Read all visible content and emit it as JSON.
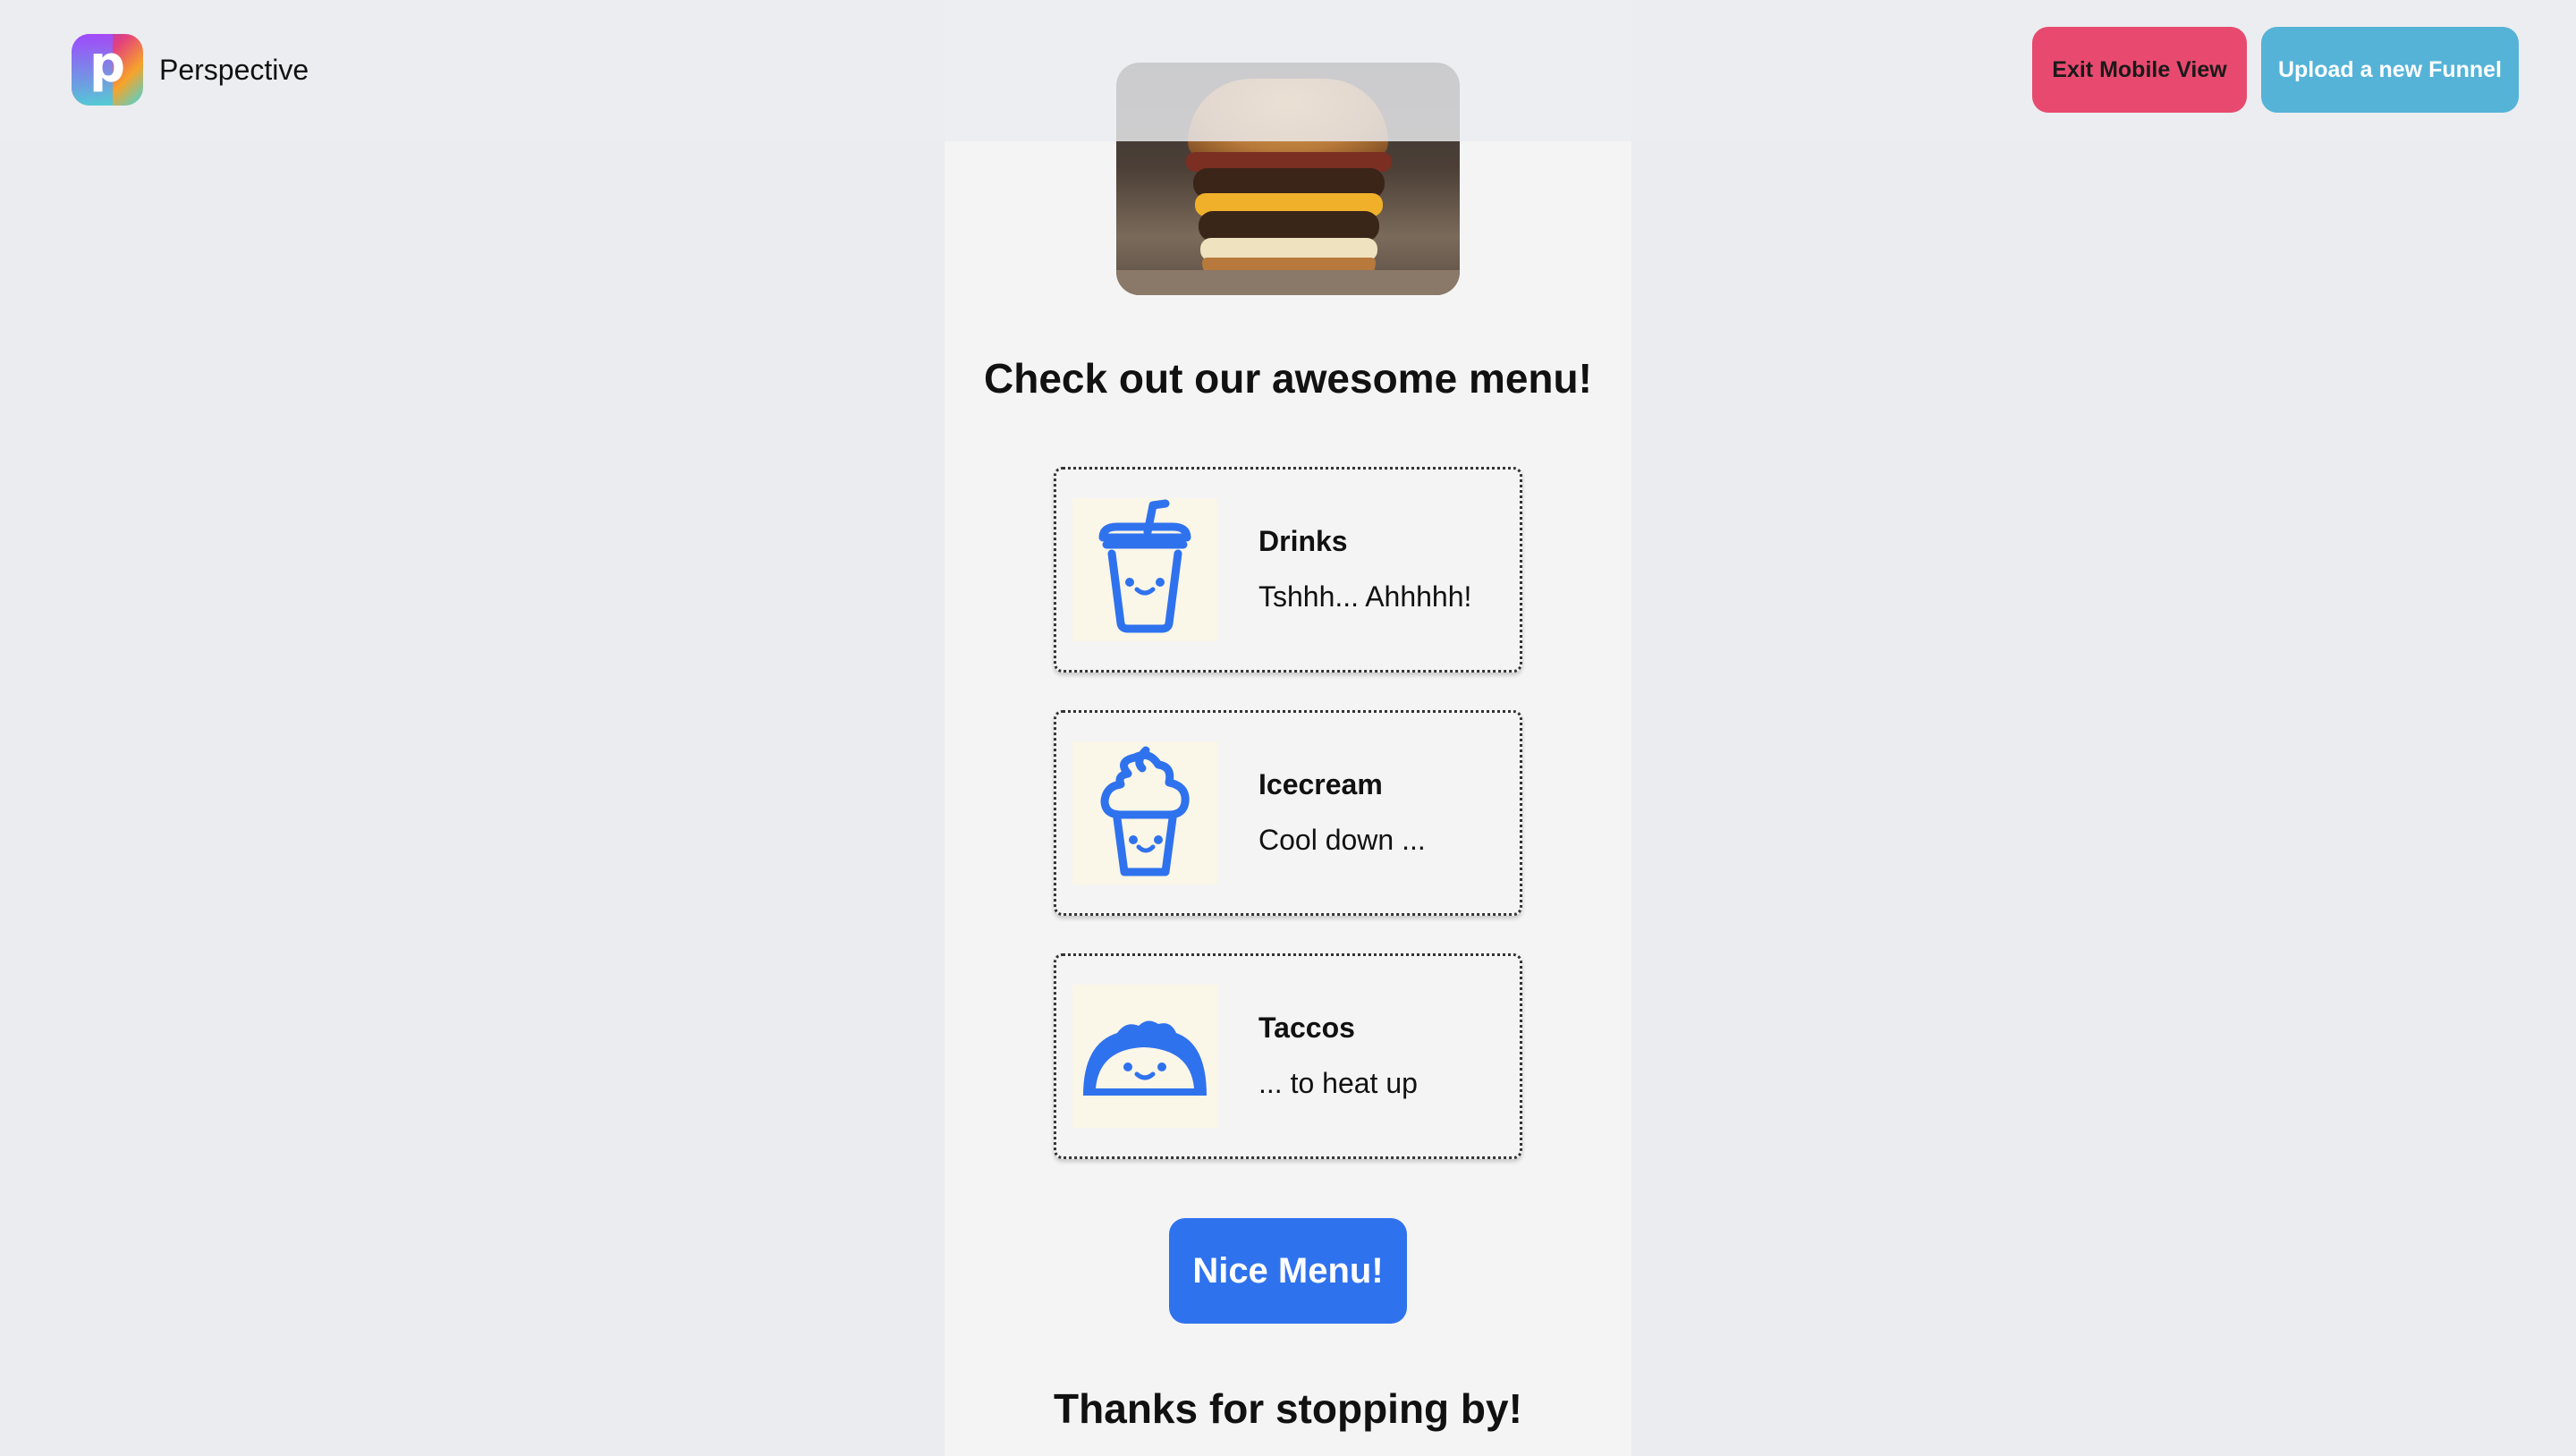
{
  "header": {
    "brand_name": "Perspective",
    "logo_letter": "p",
    "exit_button": "Exit Mobile View",
    "upload_button": "Upload a new Funnel"
  },
  "colors": {
    "exit_button": "#e84a6f",
    "upload_button": "#55b3d8",
    "primary_button": "#2f72ee",
    "icon_color": "#2f72ee"
  },
  "page": {
    "hero_image": "burger-image",
    "menu_title": "Check out our awesome menu!",
    "items": [
      {
        "title": "Drinks",
        "desc": "Tshhh... Ahhhhh!",
        "icon": "cup-icon"
      },
      {
        "title": "Icecream",
        "desc": "Cool down ...",
        "icon": "icecream-icon"
      },
      {
        "title": "Taccos",
        "desc": "... to heat up",
        "icon": "taco-icon"
      }
    ],
    "cta_button": "Nice Menu!",
    "footer_text": "Thanks for stopping by!"
  }
}
